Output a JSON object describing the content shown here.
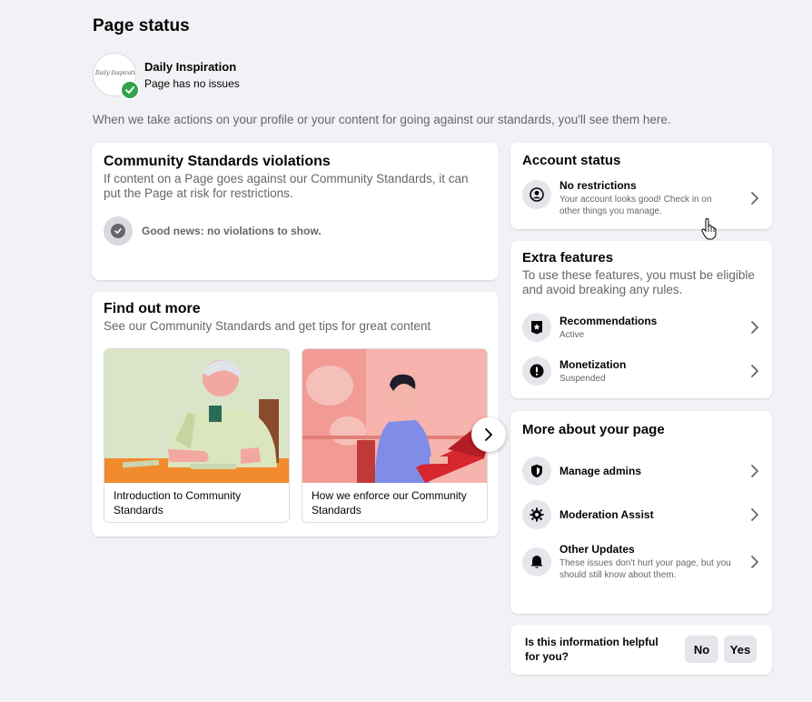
{
  "page": {
    "title": "Page status",
    "intro": "When we take actions on your profile or your content for going against our standards, you'll see them here."
  },
  "profile": {
    "name": "Daily Inspiration",
    "status": "Page has no issues",
    "avatar_text": "Daily Inspiration"
  },
  "violations": {
    "title": "Community Standards violations",
    "description": "If content on a Page goes against our Community Standards, it can put the Page at risk for restrictions.",
    "good_news": "Good news: no violations to show."
  },
  "find_out_more": {
    "title": "Find out more",
    "description": "See our Community Standards and get tips for great content",
    "articles": [
      {
        "caption": "Introduction to Community Standards"
      },
      {
        "caption": "How we enforce our Community Standards"
      }
    ]
  },
  "account_status": {
    "title": "Account status",
    "item": {
      "title": "No restrictions",
      "subtitle": "Your account looks good! Check in on other things you manage.",
      "icon": "person-circle-icon"
    }
  },
  "extra_features": {
    "title": "Extra features",
    "description": "To use these features, you must be eligible and avoid breaking any rules.",
    "items": [
      {
        "title": "Recommendations",
        "status": "Active",
        "icon": "star-badge-icon"
      },
      {
        "title": "Monetization",
        "status": "Suspended",
        "icon": "alert-icon"
      }
    ]
  },
  "more_about": {
    "title": "More about your page",
    "items": [
      {
        "title": "Manage admins",
        "icon": "shield-icon"
      },
      {
        "title": "Moderation Assist",
        "icon": "gear-icon"
      },
      {
        "title": "Other Updates",
        "subtitle": "These issues don't hurt your page, but you should still know about them.",
        "icon": "bell-icon"
      }
    ]
  },
  "feedback": {
    "question": "Is this information helpful for you?",
    "no_label": "No",
    "yes_label": "Yes"
  },
  "colors": {
    "background": "#f0f2f5",
    "success_green": "#31a24c",
    "secondary_text": "#65676b",
    "button_gray": "#e4e6eb"
  }
}
